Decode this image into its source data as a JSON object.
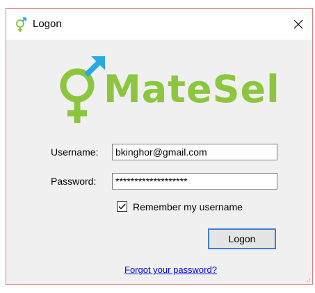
{
  "window": {
    "title": "Logon",
    "title_icon": "male-female-symbol-icon",
    "close_icon": "close-icon"
  },
  "logo": {
    "text": "MateSel",
    "icon": "male-female-symbol-icon",
    "colors": {
      "green": "#8cc63f",
      "blue": "#29abe2"
    }
  },
  "form": {
    "username_label": "Username:",
    "username_value": "bkinghor@gmail.com",
    "password_label": "Password:",
    "password_value": "*******************",
    "remember_label": "Remember my username",
    "remember_checked": true,
    "logon_label": "Logon",
    "forgot_link": "Forgot your password?"
  },
  "colors": {
    "window_border": "#e07b7b",
    "button_border": "#3c7fd6",
    "link": "#0000ee"
  }
}
